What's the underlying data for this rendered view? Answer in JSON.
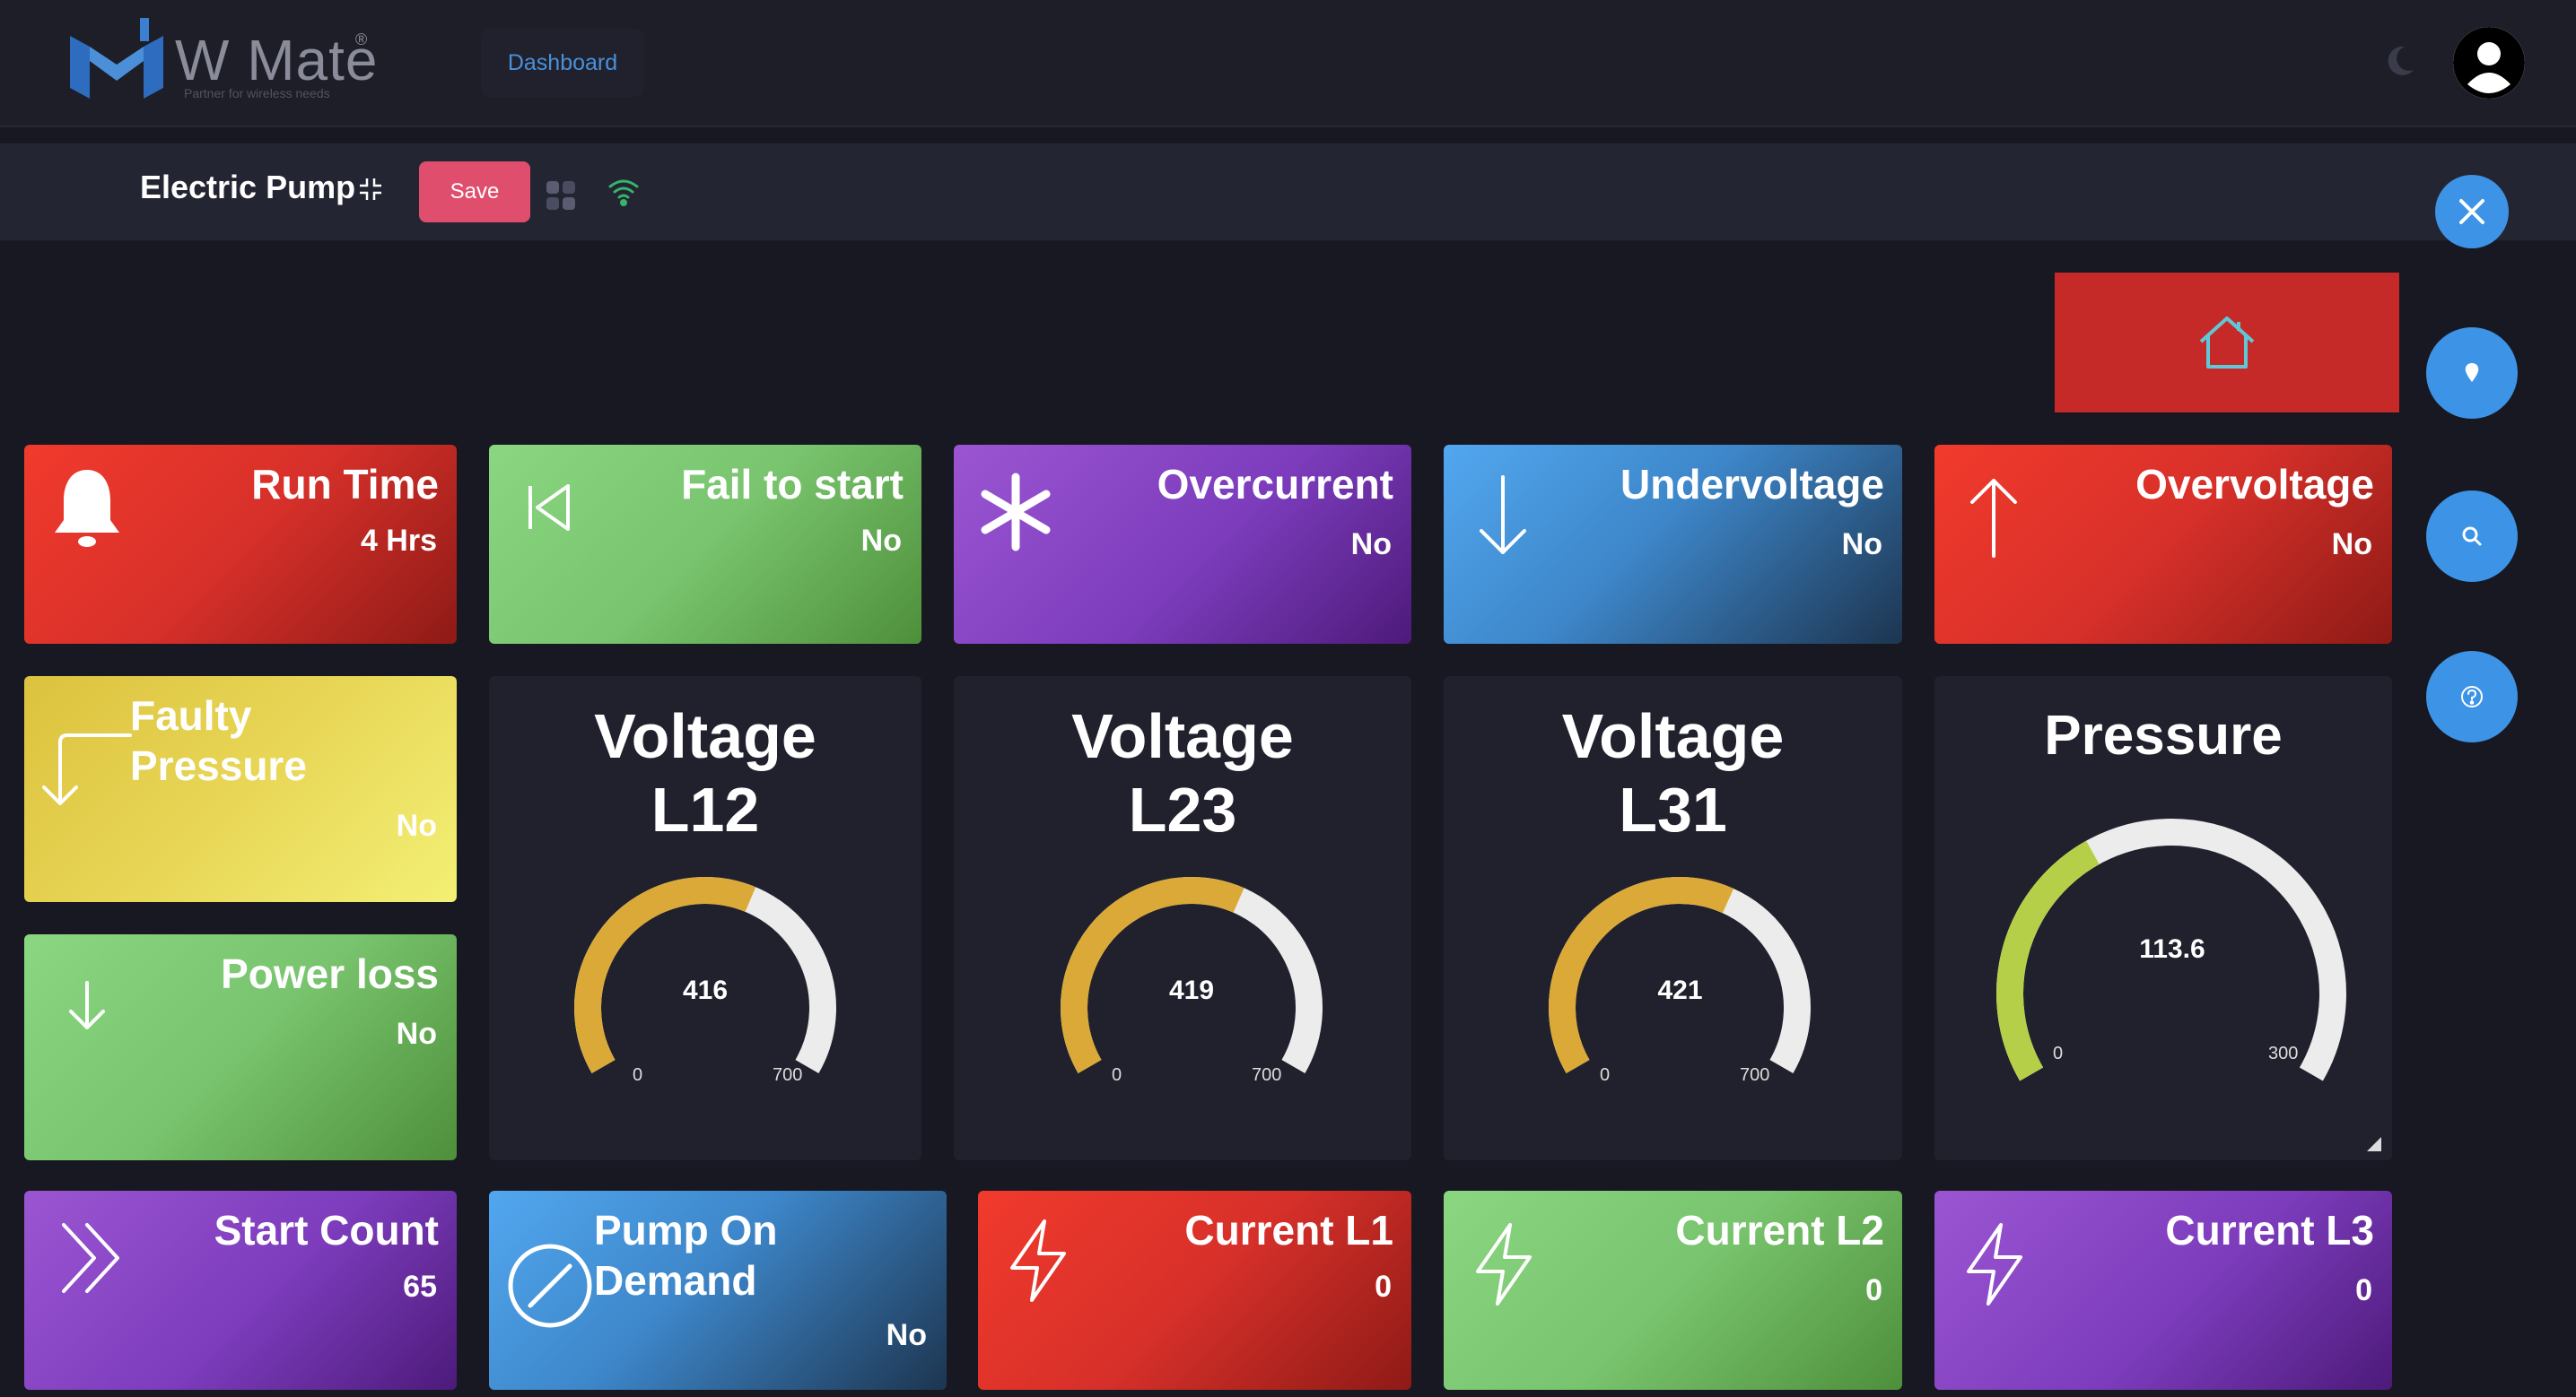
{
  "app": {
    "logo_text": "W Mate",
    "logo_reg": "®",
    "logo_tagline": "Partner for wireless needs",
    "nav_dashboard": "Dashboard"
  },
  "device": {
    "title": "Electric Pump",
    "save_label": "Save"
  },
  "colors": {
    "accent_blue": "#3d93e6",
    "save_red": "#e04e6e",
    "gauge_fill": "#dba937",
    "pressure_fill": "#b5d048",
    "gauge_track": "#ececec"
  },
  "status_cards": {
    "run_time": {
      "label": "Run Time",
      "value": "4 Hrs",
      "icon": "bell-icon"
    },
    "fail_to_start": {
      "label": "Fail to start",
      "value": "No",
      "icon": "skip-back-icon"
    },
    "overcurrent": {
      "label": "Overcurrent",
      "value": "No",
      "icon": "asterisk-icon"
    },
    "undervoltage": {
      "label": "Undervoltage",
      "value": "No",
      "icon": "arrow-down-icon"
    },
    "overvoltage": {
      "label": "Overvoltage",
      "value": "No",
      "icon": "arrow-up-icon"
    },
    "faulty_pressure": {
      "label_line1": "Faulty",
      "label_line2": "Pressure",
      "value": "No",
      "icon": "corner-down-left-icon"
    },
    "power_loss": {
      "label": "Power loss",
      "value": "No",
      "icon": "arrow-down-icon"
    },
    "start_count": {
      "label": "Start Count",
      "value": "65",
      "icon": "chevrons-right-icon"
    },
    "pump_on_demand": {
      "label_line1": "Pump On",
      "label_line2": "Demand",
      "value": "No",
      "icon": "slash-circle-icon"
    },
    "current_l1": {
      "label": "Current L1",
      "value": "0",
      "icon": "zap-icon"
    },
    "current_l2": {
      "label": "Current L2",
      "value": "0",
      "icon": "zap-icon"
    },
    "current_l3": {
      "label": "Current L3",
      "value": "0",
      "icon": "zap-icon"
    }
  },
  "gauges": {
    "v12": {
      "title_line1": "Voltage",
      "title_line2": "L12",
      "value": 416,
      "value_label": "416",
      "min": 0,
      "max": 700,
      "min_label": "0",
      "max_label": "700"
    },
    "v23": {
      "title_line1": "Voltage",
      "title_line2": "L23",
      "value": 419,
      "value_label": "419",
      "min": 0,
      "max": 700,
      "min_label": "0",
      "max_label": "700"
    },
    "v31": {
      "title_line1": "Voltage",
      "title_line2": "L31",
      "value": 421,
      "value_label": "421",
      "min": 0,
      "max": 700,
      "min_label": "0",
      "max_label": "700"
    },
    "pressure": {
      "title": "Pressure",
      "value": 113.6,
      "value_label": "113.6",
      "min": 0,
      "max": 300,
      "min_label": "0",
      "max_label": "300"
    }
  }
}
